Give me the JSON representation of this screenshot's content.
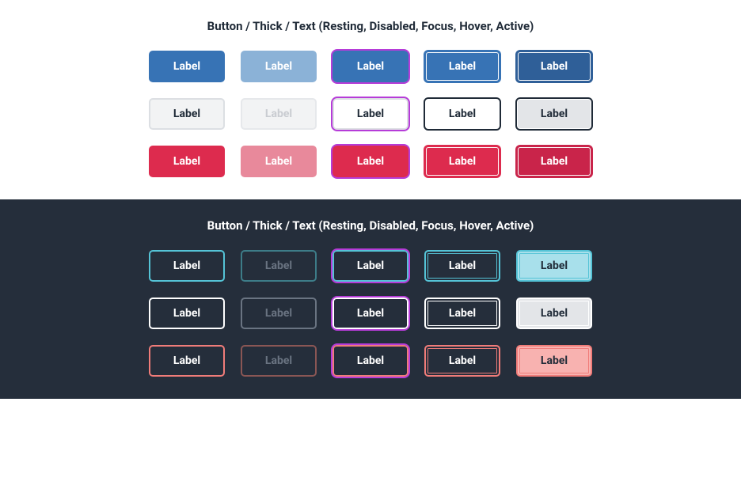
{
  "light": {
    "title": "Button / Thick / Text (Resting, Disabled, Focus, Hover, Active)",
    "label": "Label"
  },
  "dark": {
    "title": "Button / Thick / Text (Resting, Disabled, Focus, Hover, Active)",
    "label": "Label"
  }
}
